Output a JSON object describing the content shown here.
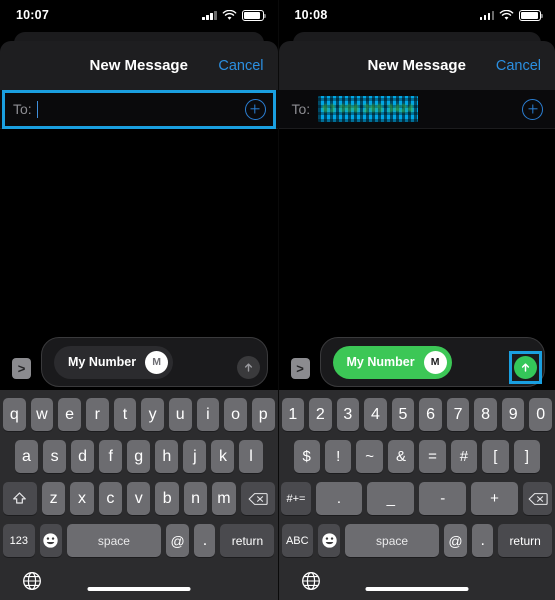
{
  "left_phone": {
    "status": {
      "time": "10:07",
      "signal_icon": "cellular-bars-icon",
      "wifi_icon": "wifi-icon",
      "battery_icon": "battery-icon"
    },
    "nav": {
      "title": "New Message",
      "cancel_label": "Cancel"
    },
    "to_field": {
      "label": "To:",
      "value": "",
      "focused": true,
      "add_contact_icon": "plus-circle-icon"
    },
    "compose": {
      "expand_label": ">",
      "chip_label": "My Number",
      "chip_avatar_initial": "M",
      "chip_style": "gray",
      "send_icon": "arrow-up-icon",
      "send_active": false
    },
    "keyboard": {
      "type": "letters",
      "row1": [
        "q",
        "w",
        "e",
        "r",
        "t",
        "y",
        "u",
        "i",
        "o",
        "p"
      ],
      "row2": [
        "a",
        "s",
        "d",
        "f",
        "g",
        "h",
        "j",
        "k",
        "l"
      ],
      "row3_shift": "shift-icon",
      "row3": [
        "z",
        "x",
        "c",
        "v",
        "b",
        "n",
        "m"
      ],
      "row3_delete": "delete-icon",
      "mode_key": "123",
      "emoji_key": "emoji-icon",
      "space_key": "space",
      "at_key": "@",
      "dot_key": ".",
      "return_key": "return",
      "globe_key": "globe-icon"
    }
  },
  "right_phone": {
    "status": {
      "time": "10:08",
      "signal_icon": "cellular-bars-icon",
      "wifi_icon": "wifi-icon",
      "battery_icon": "battery-icon"
    },
    "nav": {
      "title": "New Message",
      "cancel_label": "Cancel"
    },
    "to_field": {
      "label": "To:",
      "value": "63 006 265 3424",
      "redacted": true,
      "focused": false,
      "add_contact_icon": "plus-circle-icon"
    },
    "compose": {
      "expand_label": ">",
      "chip_label": "My Number",
      "chip_avatar_initial": "M",
      "chip_style": "green",
      "send_icon": "arrow-up-icon",
      "send_active": true,
      "send_highlighted": true
    },
    "keyboard": {
      "type": "numbers",
      "row1": [
        "1",
        "2",
        "3",
        "4",
        "5",
        "6",
        "7",
        "8",
        "9",
        "0"
      ],
      "row2": [
        "$",
        "!",
        "~",
        "&",
        "=",
        "#",
        "[",
        "]"
      ],
      "row3_mode": "#+=",
      "row3": [
        ".",
        "_",
        "-",
        "+"
      ],
      "row3_delete": "delete-icon",
      "mode_key": "ABC",
      "emoji_key": "emoji-icon",
      "space_key": "space",
      "at_key": "@",
      "dot_key": ".",
      "return_key": "return",
      "globe_key": "globe-icon"
    }
  },
  "colors": {
    "highlight": "#1a9fe0",
    "accent_blue": "#2b8fe0",
    "send_green": "#34c759",
    "chip_green": "#3cc756",
    "keyboard_bg": "#2c2c2e",
    "key_bg": "#6c6c70"
  }
}
